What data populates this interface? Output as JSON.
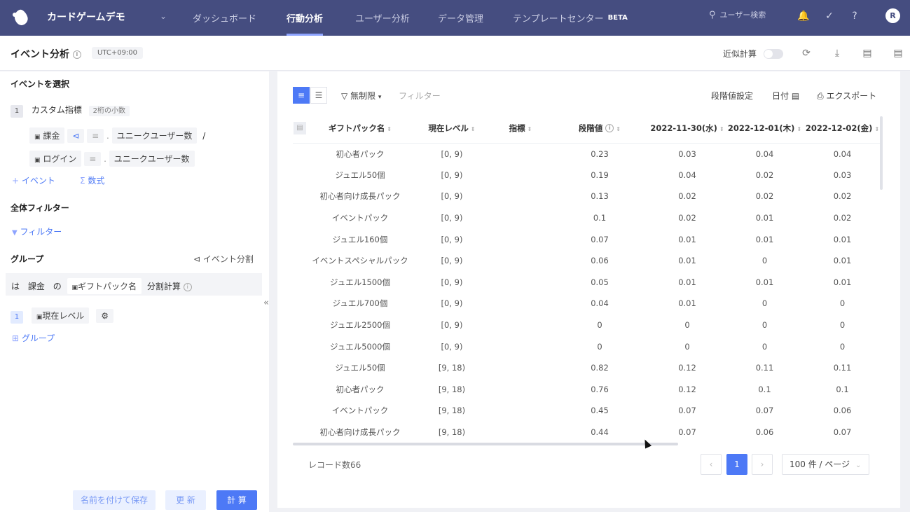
{
  "topbar": {
    "app_name": "カードゲームデモ",
    "nav": [
      "ダッシュボード",
      "行動分析",
      "ユーザー分析",
      "データ管理",
      "テンプレートセンター"
    ],
    "beta": "BETA",
    "search_placeholder": "ユーザー検索",
    "avatar": "R"
  },
  "subbar": {
    "title": "イベント分析",
    "timezone": "UTC+09:00",
    "approx_label": "近似計算"
  },
  "left": {
    "select_event": "イベントを選択",
    "metric_num": "1",
    "metric_name": "カスタム指標",
    "metric_tag": "2桁の小数",
    "row1_event": "課金",
    "row1_metric": "ユニークユーザー数",
    "slash": "/",
    "row2_event": "ログイン",
    "row2_metric": "ユニークユーザー数",
    "add_event": "イベント",
    "add_formula": "数式",
    "global_filter": "全体フィルター",
    "filter": "フィルター",
    "group": "グループ",
    "event_split": "イベント分割",
    "split_ha": "は",
    "split_event": "課金",
    "split_no": "の",
    "split_prop": "ギフトパック名",
    "split_calc": "分割計算",
    "group_num": "1",
    "group_prop": "現在レベル",
    "add_group": "グループ",
    "btn_save": "名前を付けて保存",
    "btn_update": "更 新",
    "btn_calc": "計 算"
  },
  "main": {
    "filter_unlimited": "無制限",
    "filter_placeholder": "フィルター",
    "step_setting": "段階値設定",
    "date": "日付",
    "export": "エクスポート",
    "columns": [
      "ギフトパック名",
      "現在レベル",
      "指標",
      "段階値",
      "2022-11-30(水)",
      "2022-12-01(木)",
      "2022-12-02(金)"
    ],
    "rows": [
      [
        "初心者パック",
        "[0, 9)",
        "",
        "0.23",
        "0.03",
        "0.04",
        "0.04"
      ],
      [
        "ジュエル50個",
        "[0, 9)",
        "",
        "0.19",
        "0.04",
        "0.02",
        "0.03"
      ],
      [
        "初心者向け成長パック",
        "[0, 9)",
        "",
        "0.13",
        "0.02",
        "0.02",
        "0.02"
      ],
      [
        "イベントパック",
        "[0, 9)",
        "",
        "0.1",
        "0.02",
        "0.01",
        "0.02"
      ],
      [
        "ジュエル160個",
        "[0, 9)",
        "",
        "0.07",
        "0.01",
        "0.01",
        "0.01"
      ],
      [
        "イベントスペシャルパック",
        "[0, 9)",
        "",
        "0.06",
        "0.01",
        "0",
        "0.01"
      ],
      [
        "ジュエル1500個",
        "[0, 9)",
        "",
        "0.05",
        "0.01",
        "0.01",
        "0.01"
      ],
      [
        "ジュエル700個",
        "[0, 9)",
        "",
        "0.04",
        "0.01",
        "0",
        "0"
      ],
      [
        "ジュエル2500個",
        "[0, 9)",
        "",
        "0",
        "0",
        "0",
        "0"
      ],
      [
        "ジュエル5000個",
        "[0, 9)",
        "",
        "0",
        "0",
        "0",
        "0"
      ],
      [
        "ジュエル50個",
        "[9, 18)",
        "",
        "0.82",
        "0.12",
        "0.11",
        "0.11"
      ],
      [
        "初心者パック",
        "[9, 18)",
        "",
        "0.76",
        "0.12",
        "0.1",
        "0.1"
      ],
      [
        "イベントパック",
        "[9, 18)",
        "",
        "0.45",
        "0.07",
        "0.07",
        "0.06"
      ],
      [
        "初心者向け成長パック",
        "[9, 18)",
        "",
        "0.44",
        "0.07",
        "0.06",
        "0.07"
      ]
    ],
    "records": "レコード数66",
    "page": "1",
    "page_size": "100 件 / ページ"
  }
}
